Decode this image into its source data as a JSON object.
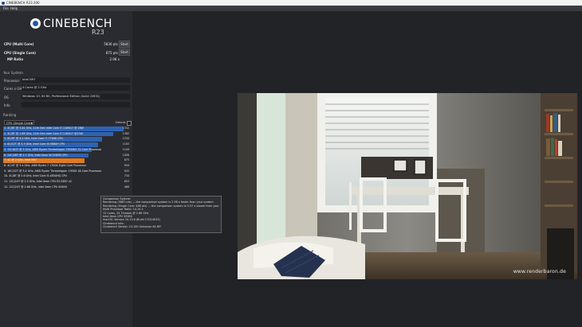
{
  "window": {
    "title": "CINEBENCH R23.200"
  },
  "menu": {
    "file": "File",
    "help": "Help"
  },
  "logo": {
    "word": "CINEBENCH",
    "version": "R23"
  },
  "tests": {
    "multi_label": "CPU (Multi Core)",
    "multi_value": "5836 pts",
    "multi_button": "Start",
    "single_label": "CPU (Single Core)",
    "single_value": "875 pts",
    "single_button": "Start",
    "ratio_label": "MP Ratio",
    "ratio_value": "2.98 x"
  },
  "system": {
    "heading": "Your System",
    "processor_label": "Processor",
    "processor_value": "Intel N97",
    "cores_label": "Cores x GHz",
    "cores_value": "4 Cores @ 2 GHz",
    "os_label": "OS",
    "os_value": "Windows 10, 64 Bit, Professional Edition (build 22631)",
    "info_label": "Info",
    "info_value": ""
  },
  "ranking": {
    "heading": "Ranking",
    "dropdown": "CPU (Single Core)",
    "details_label": "Details",
    "rows": [
      {
        "text": "1. 4C/8T @ 3.61 GHz, 11th Gen Intel Core i7-1165G7 @ 28W",
        "score": "1532",
        "fraction": 0.95,
        "color": "#2e63b3"
      },
      {
        "text": "2. 4C/8T @ 1.69 GHz, 11th Gen Intel Core i7-1165G7 @15W",
        "score": "1382",
        "fraction": 0.87,
        "color": "#2e63b3"
      },
      {
        "text": "3. 8C/8T @ 4.2 GHz, Intel Core i7-7700K CPU",
        "score": "1230",
        "fraction": 0.78,
        "color": "#2e63b3"
      },
      {
        "text": "4. 6C/12T @ 3.3 GHz, Intel Core i9-9880H CPU",
        "score": "1183",
        "fraction": 0.75,
        "color": "#2e63b3"
      },
      {
        "text": "5. 32C/64T @ 3 GHz, AMD Ryzen Threadripper 2990WX 32-Core Processor",
        "score": "1109",
        "fraction": 0.7,
        "color": "#2e63b3"
      },
      {
        "text": "6. 24C/48T @ 2.7 GHz, Intel Xeon W-3265M CPU",
        "score": "1058",
        "fraction": 0.67,
        "color": "#2e63b3"
      },
      {
        "text": "7. 4C @ 2 GHz, Intel N97",
        "score": "875",
        "fraction": 0.64,
        "color": "#e07a22"
      },
      {
        "text": "8. 4C/4T @ 3.4 GHz, AMD Ryzen 7 1700X Eight-Core Processor",
        "score": "959",
        "fraction": 0.0,
        "color": "#2e63b3"
      },
      {
        "text": "9. 16C/32T @ 3.4 GHz, AMD Ryzen Threadripper 1950X 16-Core Processor",
        "score": "945",
        "fraction": 0.0,
        "color": "#2e63b3"
      },
      {
        "text": "10. 4C/8T @ 3.6 GHz, Intel Core i5-4850HQ CPU",
        "score": "750",
        "fraction": 0.0,
        "color": "#2e63b3"
      },
      {
        "text": "11. 12C/24T @ 2.5 GHz, Intel Xeon CPU E5-2697 v2",
        "score": "653",
        "fraction": 0.0,
        "color": "#2e63b3"
      },
      {
        "text": "12. 12C/24T @ 2.66 GHz, Intel Xeon CPU X5650",
        "score": "488",
        "fraction": 0.0,
        "color": "#2e63b3"
      }
    ]
  },
  "tooltip": {
    "lines": [
      "Comparison System:",
      "Rendering (5867 pts) — the comparison system is 2.38 x faster than your system",
      "Rendering (Single Core: 486 pts) — the comparison system is 0.57 x slower than your system",
      "Multi Processor Ratio: 14.14 x",
      "12 Cores, 24 Threads @ 2.66 GHz",
      "Intel Xeon CPU X5650",
      "macOS: Version 10.13.6 (Build 17G14033)",
      "Cinebench Info:",
      "Cinebench Version 23.100 Unknown 64 BIT"
    ]
  },
  "render": {
    "watermark": "www.renderbaron.de"
  }
}
